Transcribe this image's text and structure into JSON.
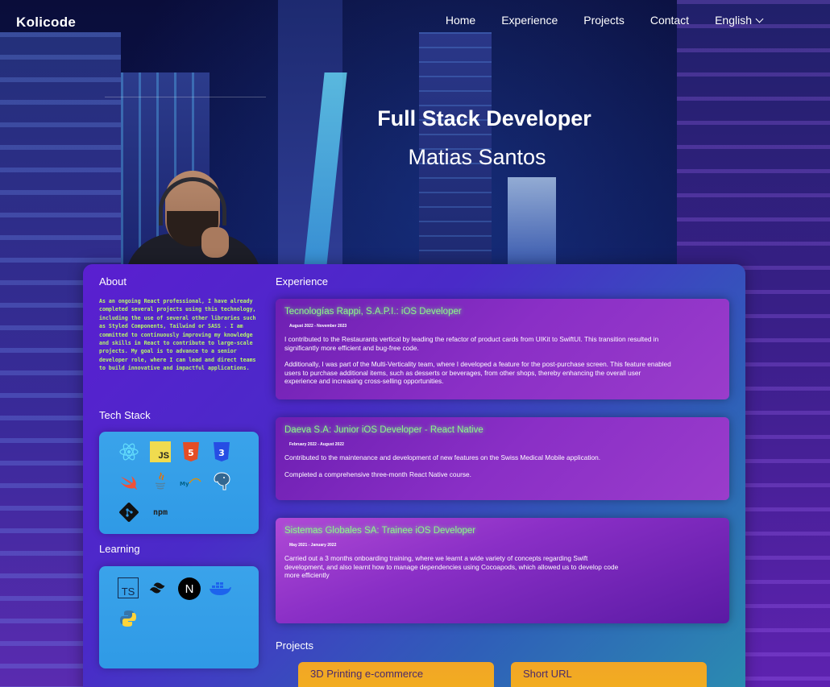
{
  "nav": {
    "logo": "Kolicode",
    "items": [
      "Home",
      "Experience",
      "Projects",
      "Contact"
    ],
    "language": "English"
  },
  "hero": {
    "title": "Full Stack Developer",
    "name": "Matias Santos"
  },
  "about": {
    "heading": "About",
    "text": "As an ongoing React professional, I have already completed several projects using this technology, including the use of several other libraries such as Styled Components, Tailwind or SASS . I am committed to continuously improving my knowledge and skills in React to contribute to large-scale projects. My goal is to advance to a senior developer role, where I can lead and direct teams to build innovative and impactful applications."
  },
  "tech_stack": {
    "heading": "Tech Stack",
    "icons": [
      "react-icon",
      "javascript-icon",
      "html5-icon",
      "css3-icon",
      "swift-icon",
      "java-icon",
      "mysql-icon",
      "postgresql-icon",
      "git-icon",
      "npm-icon"
    ],
    "badges": {
      "js": "JS",
      "html": "5",
      "css": "3",
      "npm": "npm",
      "mysql": "My"
    }
  },
  "learning": {
    "heading": "Learning",
    "icons": [
      "typescript-icon",
      "tailwind-icon",
      "nextjs-icon",
      "docker-icon",
      "python-icon"
    ],
    "badges": {
      "ts": "TS",
      "next": "N"
    }
  },
  "experience": {
    "heading": "Experience",
    "jobs": [
      {
        "title": "Tecnologías Rappi, S.A.P.I.: iOS Developer",
        "date": "August 2022 - November 2023",
        "paragraphs": [
          "I contributed to the Restaurants vertical by leading the refactor of product cards from UIKit to SwiftUI. This transition resulted in significantly more efficient and bug-free code.",
          "Additionally, I was part of the Multi-Verticality team, where I developed a feature for the post-purchase screen. This feature enabled users to purchase additional items, such as desserts or beverages, from other shops, thereby enhancing the overall user experience and increasing cross-selling opportunities."
        ]
      },
      {
        "title": "Daeva S.A: Junior iOS Developer - React Native",
        "date": "February 2022 - August 2022",
        "paragraphs": [
          "Contributed to the maintenance and development of new features on the Swiss Medical Mobile application.",
          "Completed a comprehensive three-month React Native course."
        ]
      },
      {
        "title": "Sistemas Globales SA: Trainee iOS Developer",
        "date": "May 2021 - January 2022",
        "paragraphs": [
          "Carried out a 3 months onboarding training, where we learnt a wide variety of concepts regarding Swift development, and also learnt how to manage dependencies using Cocoapods, which allowed us to develop code more efficiently"
        ]
      }
    ]
  },
  "projects": {
    "heading": "Projects",
    "items": [
      "3D Printing e-commerce",
      "Short URL"
    ]
  }
}
